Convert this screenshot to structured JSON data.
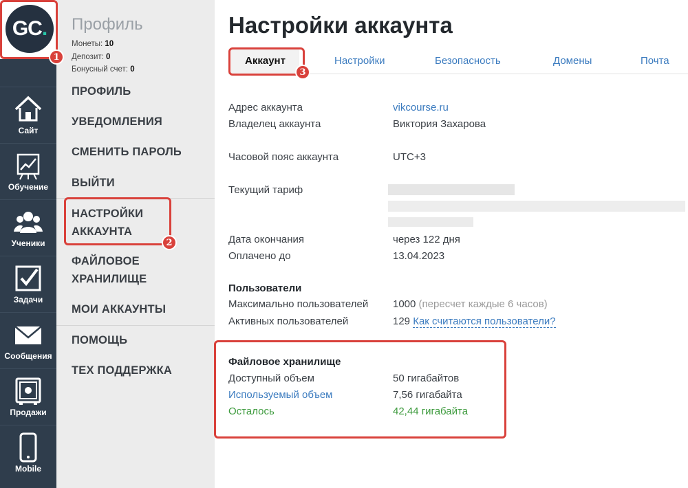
{
  "logo": {
    "text": "GC",
    "dot": "."
  },
  "leftnav": [
    {
      "label": "Сайт",
      "icon": "house-icon"
    },
    {
      "label": "Обучение",
      "icon": "chart-board-icon"
    },
    {
      "label": "Ученики",
      "icon": "users-icon"
    },
    {
      "label": "Задачи",
      "icon": "checkbox-icon"
    },
    {
      "label": "Сообщения",
      "icon": "envelope-icon"
    },
    {
      "label": "Продажи",
      "icon": "safe-icon"
    },
    {
      "label": "Mobile",
      "icon": "phone-icon"
    }
  ],
  "sidebar": {
    "title": "Профиль",
    "coins_label": "Монеты:",
    "coins": "10",
    "deposit_label": "Депозит:",
    "deposit": "0",
    "bonus_label": "Бонусный счет:",
    "bonus": "0",
    "items": [
      "ПРОФИЛЬ",
      "УВЕДОМЛЕНИЯ",
      "СМЕНИТЬ ПАРОЛЬ",
      "ВЫЙТИ",
      "НАСТРОЙКИ",
      "АККАУНТА",
      "ФАЙЛОВОЕ",
      "ХРАНИЛИЩЕ",
      "МОИ АККАУНТЫ",
      "ПОМОЩЬ",
      "ТЕХ ПОДДЕРЖКА"
    ]
  },
  "main": {
    "title": "Настройки аккаунта",
    "tabs": [
      "Аккаунт",
      "Настройки",
      "Безопасность",
      "Домены",
      "Почта"
    ],
    "rows": {
      "address_label": "Адрес аккаунта",
      "address": "vikcourse.ru",
      "owner_label": "Владелец аккаунта",
      "owner": "Виктория Захарова",
      "tz_label": "Часовой пояс аккаунта",
      "tz": "UTC+3",
      "tariff_label": "Текущий тариф",
      "end_label": "Дата окончания",
      "end": "через 122 дня",
      "paid_label": "Оплачено до",
      "paid": "13.04.2023"
    },
    "users": {
      "title": "Пользователи",
      "max_label": "Максимально пользователей",
      "max": "1000",
      "max_note": "(пересчет каждые 6 часов)",
      "active_label": "Активных пользователей",
      "active": "129",
      "active_link": "Как считаются пользователи?"
    },
    "storage": {
      "title": "Файловое хранилище",
      "avail_label": "Доступный объем",
      "avail": "50 гигабайтов",
      "used_label": "Используемый объем",
      "used": "7,56 гигабайта",
      "left_label": "Осталось",
      "left": "42,44 гигабайта"
    }
  },
  "badges": [
    "1",
    "2",
    "3"
  ],
  "colors": {
    "nav_bg": "#2f3d4c",
    "accent_red": "#d9413b",
    "link_blue": "#3b7bbf",
    "green": "#3c9a3c"
  }
}
